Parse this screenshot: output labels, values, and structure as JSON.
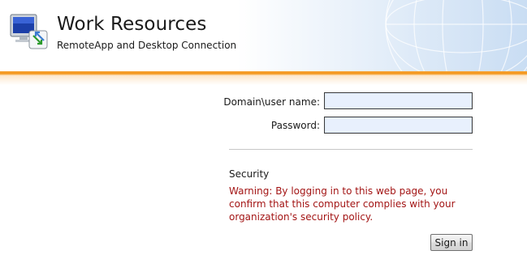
{
  "header": {
    "title": "Work Resources",
    "subtitle": "RemoteApp and Desktop Connection",
    "icon": "remote-desktop-monitor-icon",
    "accent_color": "#f39418"
  },
  "login": {
    "username_label": "Domain\\user name:",
    "username_value": "",
    "password_label": "Password:",
    "password_value": "",
    "field_background": "#e8f0fd"
  },
  "security": {
    "heading": "Security",
    "warning": "Warning: By logging in to this web page, you confirm that this computer complies with your organization's security policy.",
    "warning_color": "#a31515"
  },
  "actions": {
    "sign_in_label": "Sign in"
  }
}
